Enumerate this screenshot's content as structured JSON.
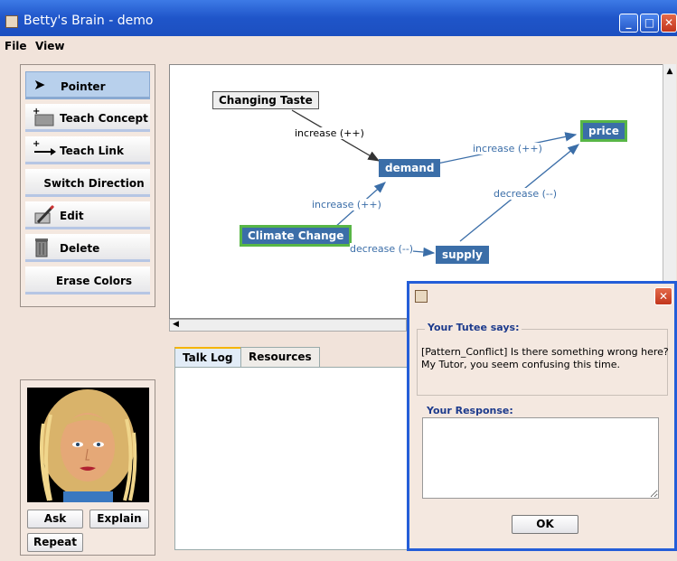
{
  "window": {
    "title": "Betty's Brain - demo"
  },
  "menu": {
    "file": "File",
    "view": "View"
  },
  "tools": [
    {
      "label": "Pointer",
      "icon": "pointer-arrow-icon",
      "selected": true
    },
    {
      "label": "Teach Concept",
      "icon": "teach-concept-icon"
    },
    {
      "label": "Teach Link",
      "icon": "teach-link-icon"
    },
    {
      "label": "Switch Direction",
      "icon": ""
    },
    {
      "label": "Edit",
      "icon": "edit-icon"
    },
    {
      "label": "Delete",
      "icon": "trash-icon"
    },
    {
      "label": "Erase Colors",
      "icon": ""
    }
  ],
  "map": {
    "nodes": {
      "changing_taste": "Changing Taste",
      "demand": "demand",
      "price": "price",
      "climate_change": "Climate Change",
      "supply": "supply"
    },
    "links": {
      "taste_demand": "increase (++)",
      "demand_price": "increase (++)",
      "climate_demand": "increase (++)",
      "climate_supply": "decrease (--)",
      "supply_price": "decrease (--)"
    },
    "colors": {
      "node": "#3b6ea8",
      "highlight": "#58b646",
      "link": "#3b6ea8"
    }
  },
  "avatar_panel": {
    "ask": "Ask",
    "explain": "Explain",
    "repeat": "Repeat"
  },
  "tabs": {
    "talk_log": "Talk Log",
    "resources": "Resources"
  },
  "dialog": {
    "tutee_title": "Your Tutee says:",
    "tutee_message": "[Pattern_Conflict] Is there something wrong here? My Tutor, you seem confusing this time.",
    "response_title": "Your Response:",
    "ok": "OK"
  }
}
